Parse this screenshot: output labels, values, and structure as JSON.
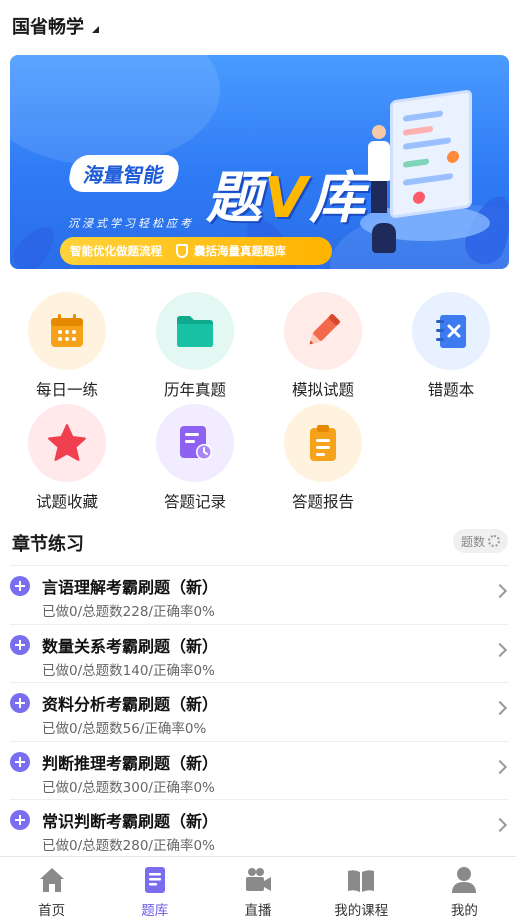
{
  "header": {
    "title": "国省畅学"
  },
  "banner": {
    "tag": "海量智能",
    "headline_a": "题",
    "headline_v": "V",
    "headline_b": "库",
    "subline": "沉浸式学习轻松应考",
    "feature_1": "智能优化做题流程",
    "feature_2": "囊括海量真题题库"
  },
  "shortcuts": [
    {
      "label": "每日一练",
      "icon": "calendar-icon",
      "bg": "#fff3e0",
      "color": "#f7a21b"
    },
    {
      "label": "历年真题",
      "icon": "folder-icon",
      "bg": "#e3f8f3",
      "color": "#18c3a5"
    },
    {
      "label": "模拟试题",
      "icon": "pencil-icon",
      "bg": "#ffece8",
      "color": "#f26a4b"
    },
    {
      "label": "错题本",
      "icon": "wrong-book-icon",
      "bg": "#e8f1ff",
      "color": "#3d7cf0"
    },
    {
      "label": "试题收藏",
      "icon": "star-icon",
      "bg": "#ffe9eb",
      "color": "#f0404f"
    },
    {
      "label": "答题记录",
      "icon": "record-icon",
      "bg": "#f1ecff",
      "color": "#8d62f2"
    },
    {
      "label": "答题报告",
      "icon": "report-icon",
      "bg": "#fff3e0",
      "color": "#f7a21b"
    }
  ],
  "chapter": {
    "title": "章节练习",
    "chip": "题数",
    "items": [
      {
        "name": "言语理解考霸刷题（新）",
        "meta": "已做0/总题数228/正确率0%"
      },
      {
        "name": "数量关系考霸刷题（新）",
        "meta": "已做0/总题数140/正确率0%"
      },
      {
        "name": "资料分析考霸刷题（新）",
        "meta": "已做0/总题数56/正确率0%"
      },
      {
        "name": "判断推理考霸刷题（新）",
        "meta": "已做0/总题数300/正确率0%"
      },
      {
        "name": "常识判断考霸刷题（新）",
        "meta": "已做0/总题数280/正确率0%"
      }
    ]
  },
  "tabs": [
    {
      "label": "首页",
      "icon": "home-icon"
    },
    {
      "label": "题库",
      "icon": "question-bank-icon",
      "active": true
    },
    {
      "label": "直播",
      "icon": "live-camera-icon"
    },
    {
      "label": "我的课程",
      "icon": "course-book-icon"
    },
    {
      "label": "我的",
      "icon": "profile-icon"
    }
  ],
  "colors": {
    "accent": "#6a5be8",
    "banner": "#2f7bf5"
  }
}
